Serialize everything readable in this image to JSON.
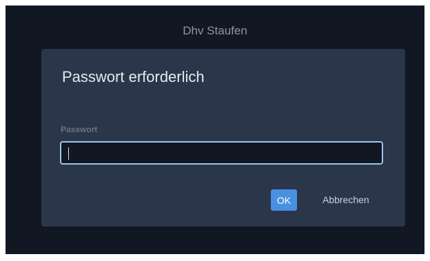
{
  "window": {
    "title": "Dhv Staufen"
  },
  "dialog": {
    "title": "Passwort erforderlich",
    "password_label": "Passwort",
    "password_value": "",
    "ok_label": "OK",
    "cancel_label": "Abbrechen"
  },
  "colors": {
    "window_background": "#111723",
    "dialog_background": "#2b364a",
    "input_background": "#111723",
    "focus_border": "#9ac6f0",
    "primary_button": "#4a90e2"
  }
}
